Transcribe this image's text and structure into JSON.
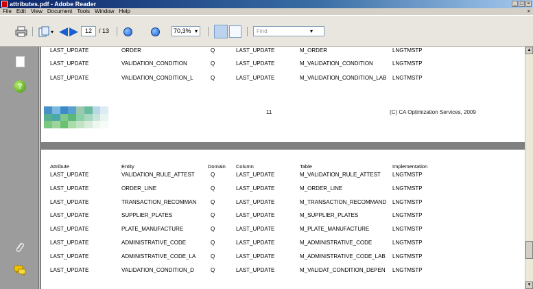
{
  "window": {
    "title": "attributes.pdf - Adobe Reader"
  },
  "menubar": {
    "items": [
      "File",
      "Edit",
      "View",
      "Document",
      "Tools",
      "Window",
      "Help"
    ]
  },
  "toolbar": {
    "page_current": "12",
    "page_total": "/ 13",
    "zoom": "70,3%",
    "find_placeholder": "Find"
  },
  "page1": {
    "rows": [
      [
        "LAST_UPDATE",
        "ORDER",
        "Q",
        "LAST_UPDATE",
        "M_ORDER",
        "LNGTMSTP"
      ],
      [
        "LAST_UPDATE",
        "VALIDATION_CONDITION",
        "Q",
        "LAST_UPDATE",
        "M_VALIDATION_CONDITION",
        "LNGTMSTP"
      ],
      [
        "LAST_UPDATE",
        "VALIDATION_CONDITION_L",
        "Q",
        "LAST_UPDATE",
        "M_VALIDATION_CONDITION_LAB",
        "LNGTMSTP"
      ]
    ],
    "page_number": "11",
    "copyright": "(C) CA Optimization Services, 2009",
    "logo_colors": [
      "#4a90c8",
      "#7ab8e0",
      "#3c8ac8",
      "#5aa0d0",
      "#9cc8b0",
      "#6abca0",
      "#b8d8e8",
      "#dcecf4",
      "#58b090",
      "#4aa8a8",
      "#80c890",
      "#5cb878",
      "#8cd0a8",
      "#a8d8c0",
      "#c8e4dc",
      "#e8f4f0",
      "#7cc880",
      "#9cd49c",
      "#6cc070",
      "#a8dca8",
      "#c0e4c4",
      "#d8ecdc",
      "#eef6f0",
      "#f6fbf8"
    ]
  },
  "page2": {
    "headers": [
      "Attribute",
      "Entity",
      "Domain",
      "Column",
      "Table",
      "Implementation"
    ],
    "rows": [
      [
        "LAST_UPDATE",
        "VALIDATION_RULE_ATTEST",
        "Q",
        "LAST_UPDATE",
        "M_VALIDATION_RULE_ATTEST",
        "LNGTMSTP"
      ],
      [
        "LAST_UPDATE",
        "ORDER_LINE",
        "Q",
        "LAST_UPDATE",
        "M_ORDER_LINE",
        "LNGTMSTP"
      ],
      [
        "LAST_UPDATE",
        "TRANSACTION_RECOMMAN",
        "Q",
        "LAST_UPDATE",
        "M_TRANSACTION_RECOMMAND",
        "LNGTMSTP"
      ],
      [
        "LAST_UPDATE",
        "SUPPLIER_PLATES",
        "Q",
        "LAST_UPDATE",
        "M_SUPPLIER_PLATES",
        "LNGTMSTP"
      ],
      [
        "LAST_UPDATE",
        "PLATE_MANUFACTURE",
        "Q",
        "LAST_UPDATE",
        "M_PLATE_MANUFACTURE",
        "LNGTMSTP"
      ],
      [
        "LAST_UPDATE",
        "ADMINISTRATIVE_CODE",
        "Q",
        "LAST_UPDATE",
        "M_ADMINISTRATIVE_CODE",
        "LNGTMSTP"
      ],
      [
        "LAST_UPDATE",
        "ADMINISTRATIVE_CODE_LA",
        "Q",
        "LAST_UPDATE",
        "M_ADMINISTRATIVE_CODE_LAB",
        "LNGTMSTP"
      ],
      [
        "LAST_UPDATE",
        "VALIDATION_CONDITION_D",
        "Q",
        "LAST_UPDATE",
        "M_VALIDAT_CONDITION_DEPEN",
        "LNGTMSTP"
      ]
    ]
  }
}
